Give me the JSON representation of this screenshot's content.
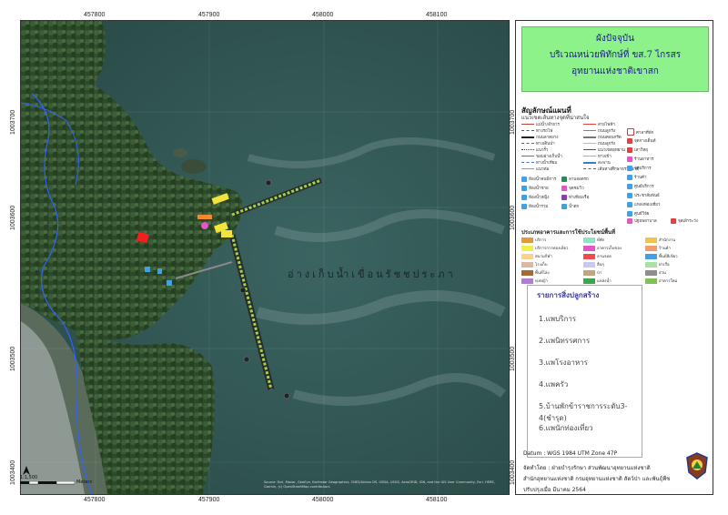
{
  "map": {
    "lake_label": "อ่างเก็บน้ำเขื่อนรัชชประภา",
    "scale_text": "1:1,500",
    "scale_unit": "Meters",
    "scale_ticks": [
      "0",
      "5",
      "10",
      "20",
      "30",
      "40"
    ],
    "credits": "Source: Esri, Maxar, GeoEye, Earthstar Geographics, CNES/Airbus DS, USDA, USGS, AeroGRID, IGN, and the GIS User Community, Esri, HERE, Garmin, (c) OpenStreetMap contributors",
    "x_ticks_top": [
      "457800",
      "457900",
      "458000",
      "458100"
    ],
    "x_ticks_bottom": [
      "457800",
      "457900",
      "458000",
      "458100"
    ],
    "y_ticks_left": [
      "1003700",
      "1003600",
      "1003500",
      "1003400"
    ],
    "y_ticks_right": [
      "1003700",
      "1003600",
      "1003500",
      "1003400"
    ]
  },
  "title": {
    "line1": "ผังปัจจุบัน",
    "line2": "บริเวณหน่วยพิทักษ์ที่ ขส.7 ไกรสร",
    "line3": "อุทยานแห่งชาติเขาสก"
  },
  "legend": {
    "heading": "สัญลักษณ์แผนที่",
    "subheading": "แนวเขตเส้นทางจุดที่น่าสนใจ",
    "line_items": [
      "แม่น้ำ/ลำธาร",
      "ทางรถไฟ",
      "ถนนลาดยาง",
      "ทางเดินป่า",
      "แนวรั้ว",
      "ขอบอ่างเก็บน้ำ",
      "ทางน้ำเทียม",
      "แนวท่อ",
      "สายไฟฟ้า",
      "ถนนลูกรัง",
      "ถนนคอนกรีต",
      "ถนนลูกรัง",
      "แนวเขตอุทยาน",
      "ทางเข้า",
      "สะพาน",
      "เส้นทางศึกษาธรรมชาติ"
    ],
    "icon_items": [
      "ห้องน้ำคนพิการ",
      "ห้องน้ำชาย",
      "ห้องน้ำหญิง",
      "ห้องน้ำรวม",
      "ลานจอดรถ",
      "จุดชมวิว",
      "ท่าเทียบเรือ",
      "น้ำตก",
      "ศาลาที่พัก",
      "จุดกางเต็นท์",
      "เสาวิทยุ",
      "ร้านอาหาร",
      "จุดบริการ",
      "ร้านค้า",
      "ศูนย์บริการ",
      "ประชาสัมพันธ์",
      "แหล่งท่องเที่ยว",
      "ศูนย์วิจัย",
      "ปฐมพยาบาล",
      "จุดเฝ้าระวัง"
    ],
    "landuse_heading": "ประเภทอาคารและการใช้ประโยชน์พื้นที่",
    "landuse": [
      {
        "label": "บริการ",
        "color": "#e39a3b"
      },
      {
        "label": "ที่พัก",
        "color": "#8fe3c6"
      },
      {
        "label": "สำนักงาน",
        "color": "#f0c44c"
      },
      {
        "label": "บริการการท่องเที่ยว",
        "color": "#f2f046"
      },
      {
        "label": "อาคารเก็บของ",
        "color": "#e754c8"
      },
      {
        "label": "ร้านค้า",
        "color": "#f39b6a"
      },
      {
        "label": "สนามกีฬา",
        "color": "#ffcf8e"
      },
      {
        "label": "ลานจอด",
        "color": "#f04a4a"
      },
      {
        "label": "พื้นที่สีเขียว",
        "color": "#3fa2e8"
      },
      {
        "label": "โรงเก็บ",
        "color": "#d9b9a2"
      },
      {
        "label": "อื่นๆ",
        "color": "#c8c8f0"
      },
      {
        "label": "ท่าเรือ",
        "color": "#a6e3a1"
      },
      {
        "label": "พื้นที่โล่ง",
        "color": "#a56a2e"
      },
      {
        "label": "ป่า",
        "color": "#c4a47e"
      },
      {
        "label": "สวน",
        "color": "#8e8e8e"
      },
      {
        "label": "ทุ่งหญ้า",
        "color": "#b37bd9"
      },
      {
        "label": "แหล่งน้ำ",
        "color": "#3ea64a"
      },
      {
        "label": "อาคารใหม่",
        "color": "#7ec34f"
      }
    ]
  },
  "facilities": {
    "heading": "รายการสิ่งปลูกสร้าง",
    "items": [
      "1.แพบริการ",
      "2.แพนิทรรศการ",
      "3.แพโรงอาหาร",
      "4.แพครัว",
      "5.บ้านพักข้าราชการระดับ3-4(ชำรุด)",
      "6.แพนักท่องเที่ยว"
    ]
  },
  "info": {
    "datum": "Datum  : WGS 1984 UTM Zone 47P",
    "made_by": "จัดทำโดย  : ฝ่ายบำรุงรักษา ส่วนพัฒนาอุทยานแห่งชาติ",
    "org": "สำนักอุทยานแห่งชาติ  กรมอุทยานแห่งชาติ สัตว์ป่า และพันธุ์พืช",
    "updated": "ปรับปรุงเมื่อ มีนาคม 2564"
  },
  "colors": {
    "title_bg": "#8df28a",
    "water": "#2f5653",
    "forest": "#2a4a2a",
    "pier": "#9ad84a"
  }
}
